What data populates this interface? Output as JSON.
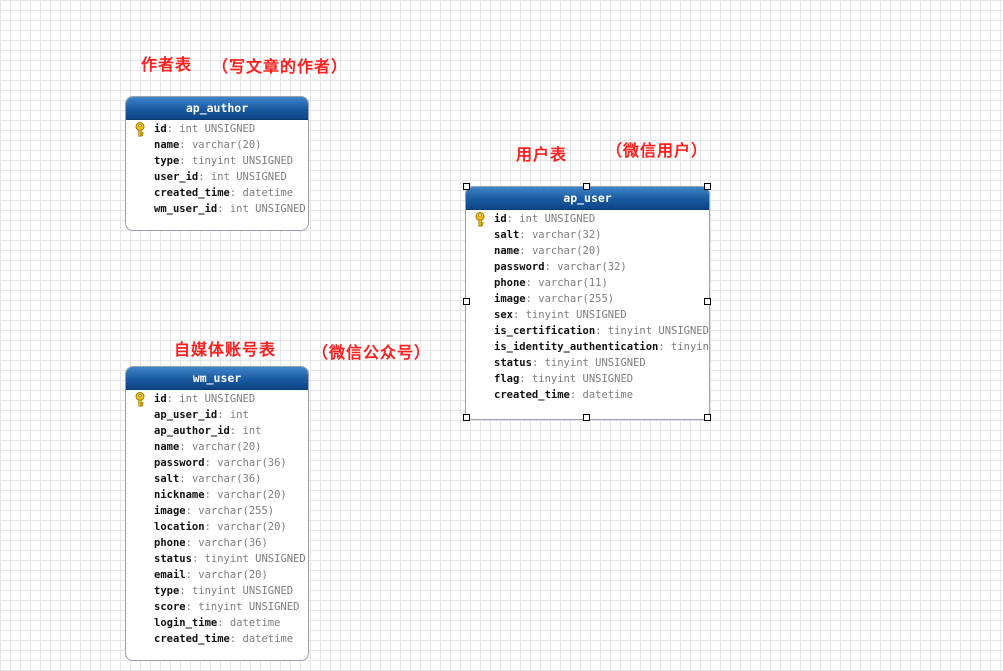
{
  "annotations": {
    "author_title": "作者表",
    "author_note": "（写文章的作者）",
    "user_title": "用户表",
    "user_note": "（微信用户）",
    "wm_title": "自媒体账号表",
    "wm_note": "（微信公众号）"
  },
  "tables": {
    "ap_author": {
      "name": "ap_author",
      "fields": [
        {
          "name": "id",
          "type": ": int UNSIGNED",
          "primary_key": true
        },
        {
          "name": "name",
          "type": ": varchar(20)"
        },
        {
          "name": "type",
          "type": ": tinyint UNSIGNED"
        },
        {
          "name": "user_id",
          "type": ": int UNSIGNED"
        },
        {
          "name": "created_time",
          "type": ": datetime"
        },
        {
          "name": "wm_user_id",
          "type": ": int UNSIGNED"
        }
      ]
    },
    "ap_user": {
      "name": "ap_user",
      "selected": true,
      "fields": [
        {
          "name": "id",
          "type": ": int UNSIGNED",
          "primary_key": true
        },
        {
          "name": "salt",
          "type": ": varchar(32)"
        },
        {
          "name": "name",
          "type": ": varchar(20)"
        },
        {
          "name": "password",
          "type": ": varchar(32)"
        },
        {
          "name": "phone",
          "type": ": varchar(11)"
        },
        {
          "name": "image",
          "type": ": varchar(255)"
        },
        {
          "name": "sex",
          "type": ": tinyint UNSIGNED"
        },
        {
          "name": "is_certification",
          "type": ": tinyint UNSIGNED"
        },
        {
          "name": "is_identity_authentication",
          "type": ": tinyint"
        },
        {
          "name": "status",
          "type": ": tinyint UNSIGNED"
        },
        {
          "name": "flag",
          "type": ": tinyint UNSIGNED"
        },
        {
          "name": "created_time",
          "type": ": datetime"
        }
      ]
    },
    "wm_user": {
      "name": "wm_user",
      "fields": [
        {
          "name": "id",
          "type": ": int UNSIGNED",
          "primary_key": true
        },
        {
          "name": "ap_user_id",
          "type": ": int"
        },
        {
          "name": "ap_author_id",
          "type": ": int"
        },
        {
          "name": "name",
          "type": ": varchar(20)"
        },
        {
          "name": "password",
          "type": ": varchar(36)"
        },
        {
          "name": "salt",
          "type": ": varchar(36)"
        },
        {
          "name": "nickname",
          "type": ": varchar(20)"
        },
        {
          "name": "image",
          "type": ": varchar(255)"
        },
        {
          "name": "location",
          "type": ": varchar(20)"
        },
        {
          "name": "phone",
          "type": ": varchar(36)"
        },
        {
          "name": "status",
          "type": ": tinyint UNSIGNED"
        },
        {
          "name": "email",
          "type": ": varchar(20)"
        },
        {
          "name": "type",
          "type": ": tinyint UNSIGNED"
        },
        {
          "name": "score",
          "type": ": tinyint UNSIGNED"
        },
        {
          "name": "login_time",
          "type": ": datetime"
        },
        {
          "name": "created_time",
          "type": ": datetime"
        }
      ]
    }
  },
  "colors": {
    "annotation": "#ff1e1e",
    "header_top": "#3e84c8",
    "header_bottom": "#0e4588",
    "field_type": "#7d7d7d",
    "key_icon": "#f2c21b"
  },
  "icons": {
    "primary_key": "key-icon"
  }
}
